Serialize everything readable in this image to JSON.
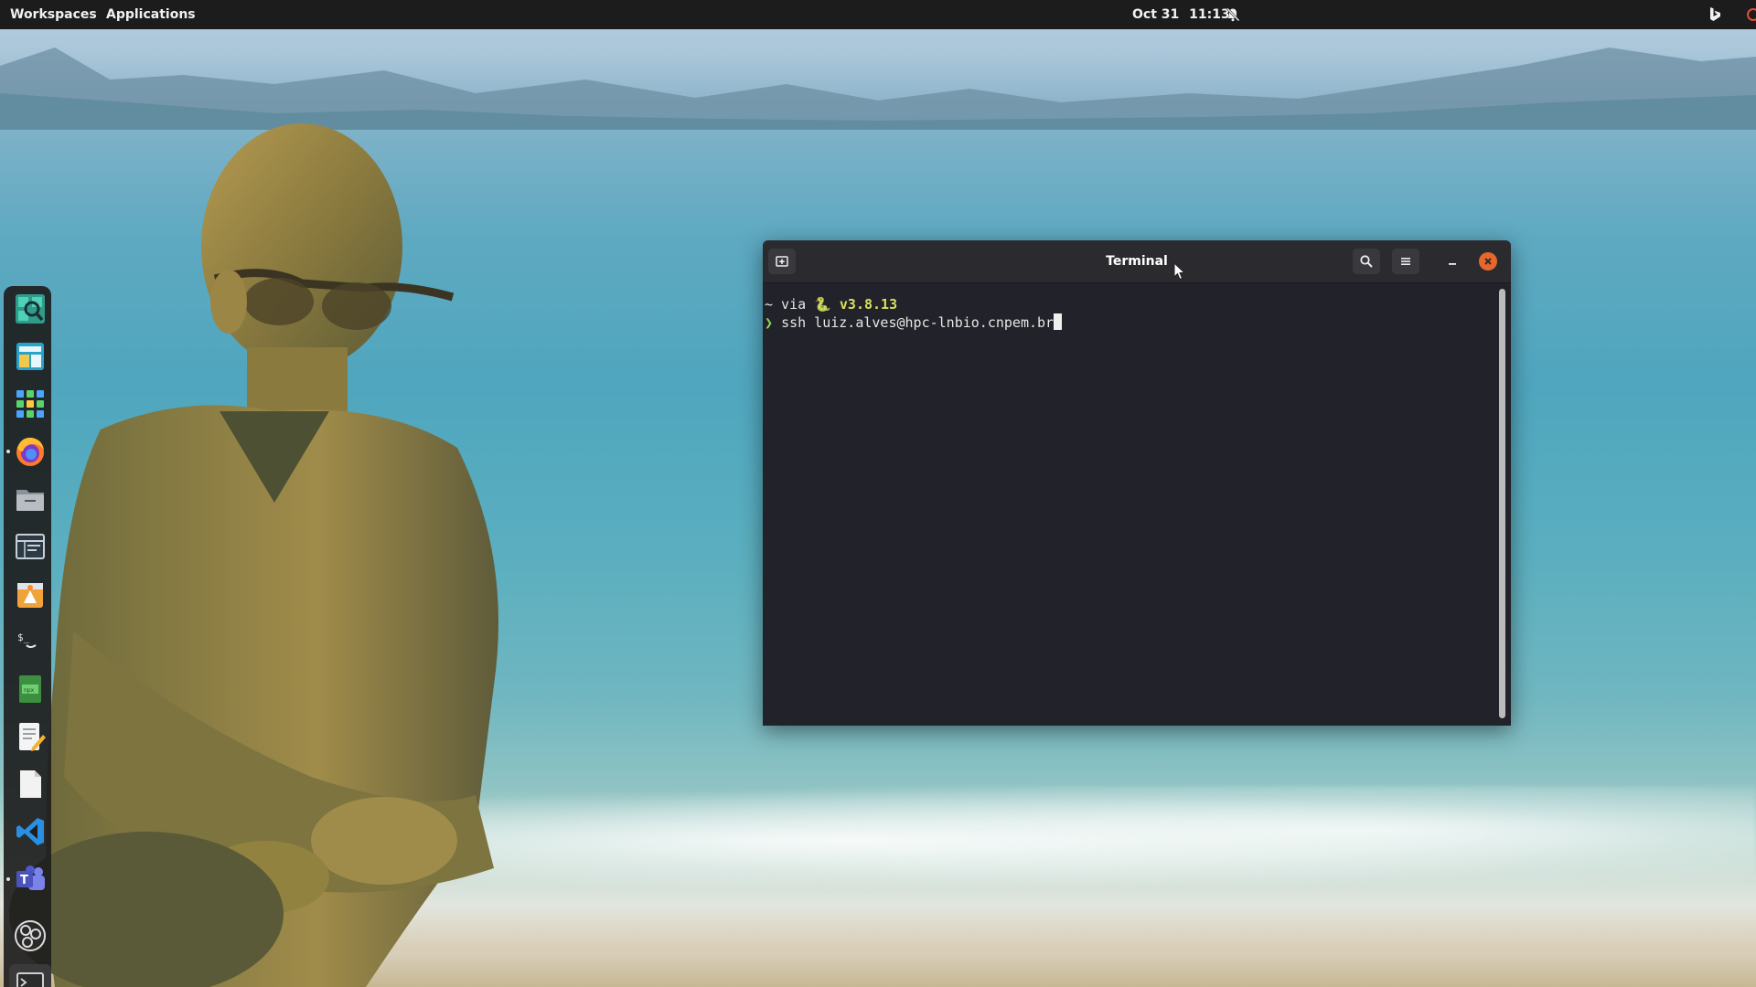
{
  "topbar": {
    "workspaces_label": "Workspaces",
    "applications_label": "Applications",
    "date": "Oct 31",
    "time": "11:13"
  },
  "dock": {
    "items": [
      {
        "icon": "search-icon"
      },
      {
        "icon": "window-manager-icon"
      },
      {
        "icon": "app-grid-icon"
      },
      {
        "icon": "firefox-icon"
      },
      {
        "icon": "files-icon"
      },
      {
        "icon": "system-monitor-icon"
      },
      {
        "icon": "app-store-icon"
      },
      {
        "icon": "terminal-prompt-icon"
      },
      {
        "icon": "spreadsheet-icon"
      },
      {
        "icon": "text-editor-icon"
      },
      {
        "icon": "document-icon"
      },
      {
        "icon": "vscode-icon"
      },
      {
        "icon": "teams-icon"
      },
      {
        "icon": "obs-icon"
      },
      {
        "icon": "terminal-icon"
      }
    ]
  },
  "terminal": {
    "title": "Terminal",
    "line1_prefix": "~ via ",
    "python_glyph": "🐍",
    "python_version": "v3.8.13",
    "prompt_symbol": "❯",
    "command": "ssh luiz.alves@hpc-lnbio.cnpem.br"
  },
  "colors": {
    "topbar_bg": "#1c1c1c",
    "terminal_bg": "#22222a",
    "close_button": "#e8672c",
    "python_version_text": "#d8e05a",
    "prompt_arrow": "#8ad85a"
  }
}
